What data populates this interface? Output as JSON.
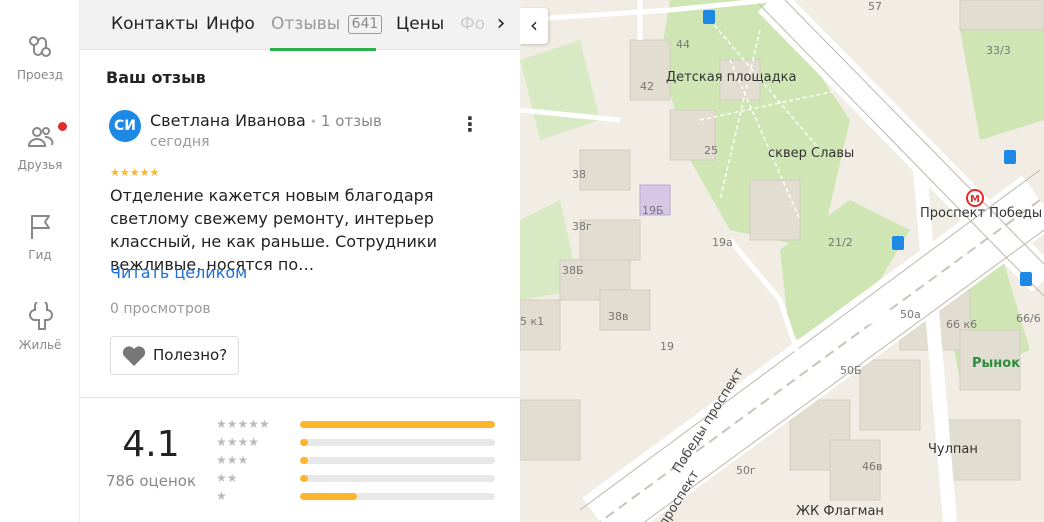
{
  "nav": {
    "items": [
      {
        "label": "Проезд",
        "icon": "route-icon"
      },
      {
        "label": "Друзья",
        "icon": "friends-icon"
      },
      {
        "label": "Гид",
        "icon": "flag-icon"
      },
      {
        "label": "Жильё",
        "icon": "housing-icon"
      }
    ]
  },
  "tabs": {
    "contacts": "Контакты",
    "info": "Инфо",
    "reviews": "Отзывы",
    "reviews_count": "641",
    "prices": "Цены",
    "photos": "Фото"
  },
  "review": {
    "section_title": "Ваш отзыв",
    "avatar_initials": "СИ",
    "author": "Светлана Иванова",
    "author_reviews": "1 отзыв",
    "date": "сегодня",
    "stars": "★★★★★",
    "text": "Отделение кажется новым благодаря светлому свежему ремонту, интерьер классный, не как раньше. Сотрудники вежливые, носятся по…",
    "read_more": "Читать целиком",
    "views": "0 просмотров",
    "useful": "Полезно?"
  },
  "rating": {
    "value": "4.1",
    "count": "786 оценок",
    "distribution": [
      {
        "stars": "★★★★★",
        "fraction": 1.0
      },
      {
        "stars": "★★★★",
        "fraction": 0.04
      },
      {
        "stars": "★★★",
        "fraction": 0.04
      },
      {
        "stars": "★★",
        "fraction": 0.04
      },
      {
        "stars": "★",
        "fraction": 0.29
      }
    ]
  },
  "map": {
    "labels": {
      "playground": "Детская площадка",
      "square": "сквер Славы",
      "metro": "Проспект Победы",
      "market": "Рынок",
      "chulpan": "Чулпан",
      "flagman": "ЖК Флагман",
      "avenue": "Победы проспект",
      "avenue2": "проспект",
      "n57": "57",
      "n44": "44",
      "n42": "42",
      "n25": "25",
      "n38": "38",
      "n19b": "19Б",
      "n38g": "38г",
      "n38b": "38Б",
      "n38v": "38в",
      "n19a": "19а",
      "n21_2": "21/2",
      "n19": "19",
      "n50a": "50а",
      "n66k6": "66 к6",
      "n66_6": "66/6",
      "n50b": "50Б",
      "n46v": "46в",
      "n50g": "50г",
      "n33_3": "33/3",
      "n5k1": "5 к1"
    }
  },
  "colors": {
    "accent_green": "#2ab14a",
    "link_blue": "#1e6fd9",
    "star_yellow": "#fdb62b",
    "metro_red": "#e52b2b"
  }
}
